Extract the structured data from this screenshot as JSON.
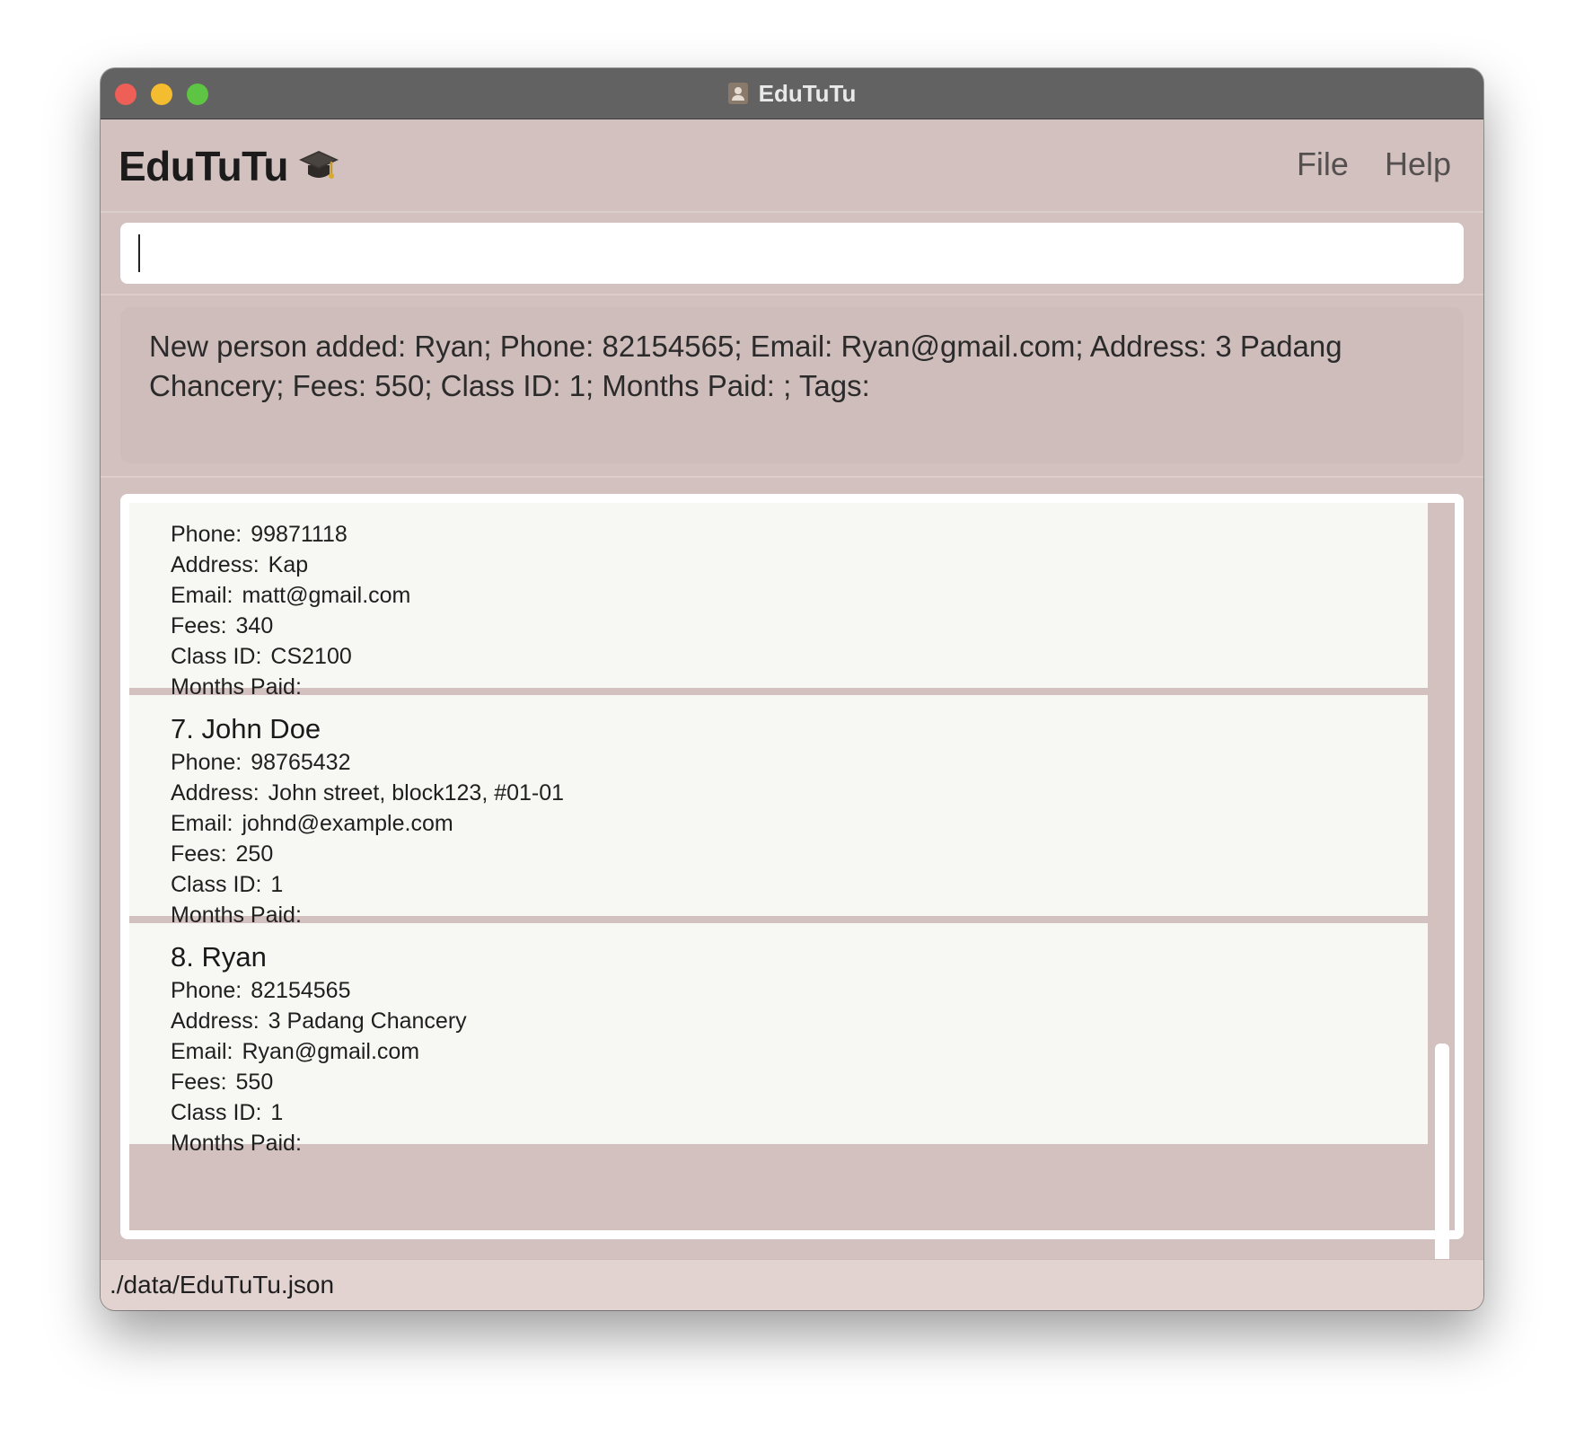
{
  "window": {
    "title": "EduTuTu"
  },
  "header": {
    "app_name": "EduTuTu",
    "logo_icon": "graduation-cap-icon",
    "menu": [
      {
        "label": "File"
      },
      {
        "label": "Help"
      }
    ]
  },
  "command": {
    "value": "",
    "placeholder": ""
  },
  "result": {
    "message": "New person added: Ryan; Phone: 82154565; Email: Ryan@gmail.com; Address: 3 Padang Chancery; Fees: 550; Class ID: 1; Months Paid: ; Tags:"
  },
  "labels": {
    "phone": "Phone:",
    "address": "Address:",
    "email": "Email:",
    "fees": "Fees:",
    "class_id": "Class ID:",
    "months_paid": "Months Paid:"
  },
  "persons": [
    {
      "name": "",
      "phone": "99871118",
      "address": "Kap",
      "email": "matt@gmail.com",
      "fees": "340",
      "class_id": "CS2100",
      "months_paid": ""
    },
    {
      "name": "7. John Doe",
      "phone": "98765432",
      "address": "John street, block123, #01-01",
      "email": "johnd@example.com",
      "fees": "250",
      "class_id": "1",
      "months_paid": ""
    },
    {
      "name": "8. Ryan",
      "phone": "82154565",
      "address": "3 Padang Chancery",
      "email": "Ryan@gmail.com",
      "fees": "550",
      "class_id": "1",
      "months_paid": ""
    }
  ],
  "status_bar": {
    "path": "./data/EduTuTu.json"
  },
  "colors": {
    "background": "#d3c1bf",
    "card": "#f7f7f3",
    "titlebar": "#626262"
  }
}
